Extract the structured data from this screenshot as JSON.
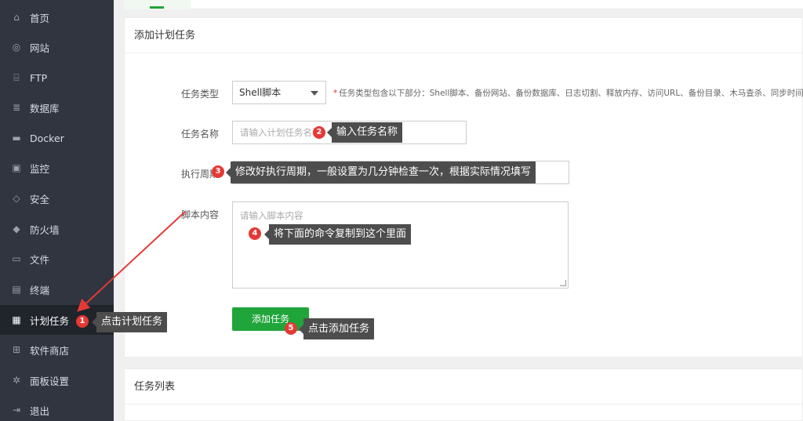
{
  "sidebar": {
    "items": [
      {
        "label": "首页",
        "icon": "home-icon",
        "glyph": "⌂"
      },
      {
        "label": "网站",
        "icon": "globe-icon",
        "glyph": "◎"
      },
      {
        "label": "FTP",
        "icon": "ftp-icon",
        "glyph": "⌸"
      },
      {
        "label": "数据库",
        "icon": "database-icon",
        "glyph": "≣"
      },
      {
        "label": "Docker",
        "icon": "docker-icon",
        "glyph": "▬"
      },
      {
        "label": "监控",
        "icon": "monitor-icon",
        "glyph": "▣"
      },
      {
        "label": "安全",
        "icon": "shield-check-icon",
        "glyph": "◇"
      },
      {
        "label": "防火墙",
        "icon": "firewall-shield-icon",
        "glyph": "◆"
      },
      {
        "label": "文件",
        "icon": "folder-icon",
        "glyph": "▭"
      },
      {
        "label": "终端",
        "icon": "terminal-icon",
        "glyph": "▤"
      },
      {
        "label": "计划任务",
        "icon": "calendar-icon",
        "glyph": "▦",
        "active": true
      },
      {
        "label": "软件商店",
        "icon": "apps-grid-icon",
        "glyph": "⊞"
      },
      {
        "label": "面板设置",
        "icon": "gear-icon",
        "glyph": "✲"
      },
      {
        "label": "退出",
        "icon": "logout-icon",
        "glyph": "⇥"
      }
    ]
  },
  "add_panel": {
    "title": "添加计划任务",
    "type_label": "任务类型",
    "type_value": "Shell脚本",
    "type_help": "任务类型包含以下部分：Shell脚本、备份网站、备份数据库、日志切割、释放内存、访问URL、备份目录、木马查杀、同步时间",
    "name_label": "任务名称",
    "name_placeholder": "请输入计划任务名称",
    "period_label": "执行周期",
    "script_label": "脚本内容",
    "script_placeholder": "请输入脚本内容",
    "submit_label": "添加任务"
  },
  "list_panel": {
    "title": "任务列表"
  },
  "annotations": {
    "n1": "1",
    "t1": "点击计划任务",
    "n2": "2",
    "t2": "输入任务名称",
    "n3": "3",
    "t3": "修改好执行周期，一般设置为几分钟检查一次，根据实际情况填写",
    "n4": "4",
    "t4": "将下面的命令复制到这个里面",
    "n5": "5",
    "t5": "点击添加任务"
  },
  "colors": {
    "sidebar_bg": "#303540",
    "accent_green": "#20a53a",
    "badge_red": "#e53935",
    "tooltip_bg": "#4d4d4d"
  }
}
